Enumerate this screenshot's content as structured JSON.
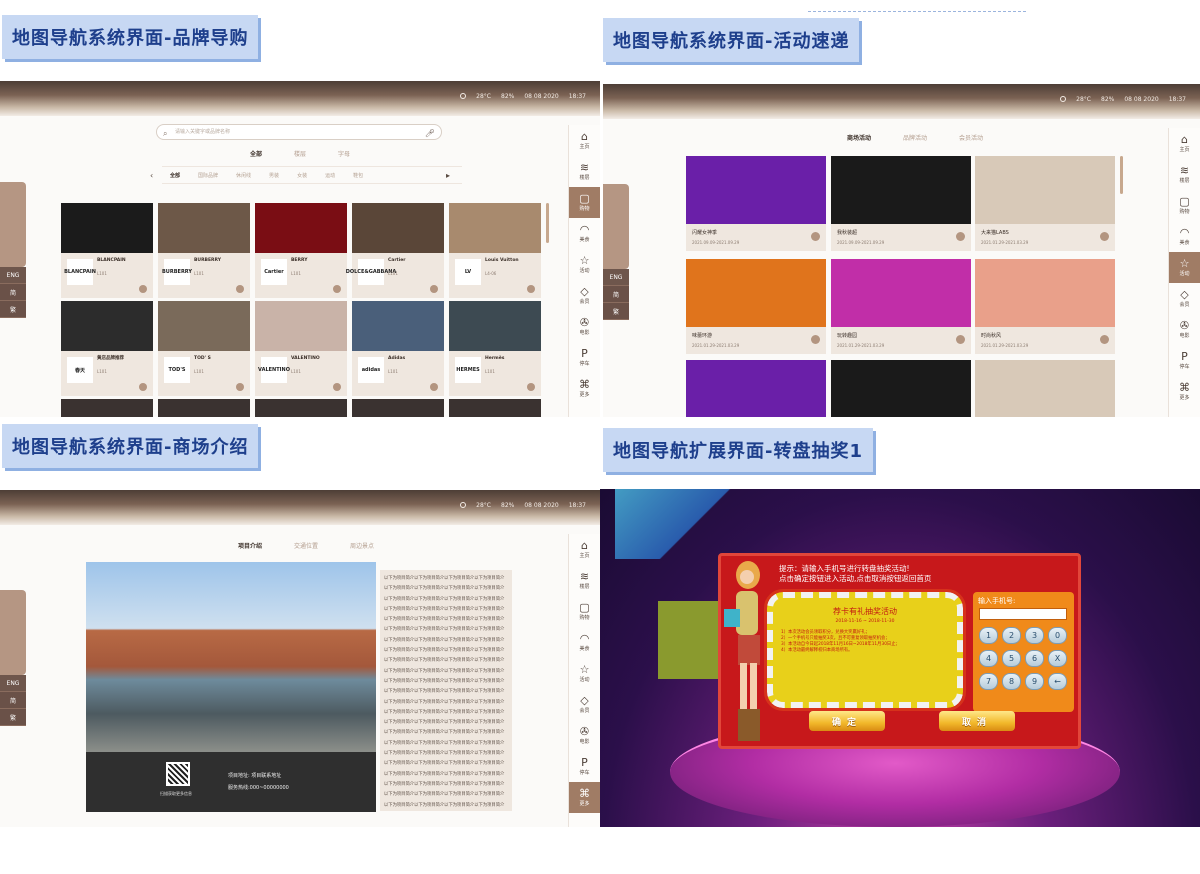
{
  "sections": [
    {
      "title": "地图导航系统界面-品牌导购"
    },
    {
      "title": "地图导航系统界面-活动速递"
    },
    {
      "title": "地图导航系统界面-商场介绍"
    },
    {
      "title": "地图导航扩展界面-转盘抽奖1"
    }
  ],
  "status": {
    "temp": "28°C",
    "humidity": "82%",
    "date": "08 08 2020",
    "time": "18:37"
  },
  "rail": [
    {
      "label": "主页",
      "icon": "home-icon",
      "glyph": "⌂"
    },
    {
      "label": "楼层",
      "icon": "layers-icon",
      "glyph": "≋"
    },
    {
      "label": "购物",
      "icon": "shopping-bag-icon",
      "glyph": "▢"
    },
    {
      "label": "美食",
      "icon": "dish-icon",
      "glyph": "◠"
    },
    {
      "label": "活动",
      "icon": "star-icon",
      "glyph": "☆"
    },
    {
      "label": "会员",
      "icon": "diamond-icon",
      "glyph": "◇"
    },
    {
      "label": "电影",
      "icon": "film-reel-icon",
      "glyph": "✇"
    },
    {
      "label": "停车",
      "icon": "parking-icon",
      "glyph": "P"
    },
    {
      "label": "更多",
      "icon": "gamepad-icon",
      "glyph": "⌘"
    }
  ],
  "lang": {
    "eng": "ENG",
    "simplified": "简",
    "traditional": "繁"
  },
  "brand": {
    "search_placeholder": "请输入关键字或品牌名称",
    "tabs": [
      "全部",
      "楼层",
      "字母"
    ],
    "categories": [
      "全部",
      "国际品牌",
      "休闲线",
      "男装",
      "女装",
      "运动",
      "鞋包"
    ],
    "cards": [
      {
        "name": "BLANCPAIN",
        "logo": "BLANCPAIN",
        "info": "L101",
        "color": "#1b1b1b"
      },
      {
        "name": "BURBERRY",
        "logo": "BURBERRY",
        "info": "L101",
        "color": "#6d5848"
      },
      {
        "name": "BERRY",
        "logo": "Cartier",
        "info": "L101",
        "color": "#7a0d14"
      },
      {
        "name": "Cartier",
        "logo": "DOLCE&GABBANA",
        "info": "L101",
        "color": "#5a4638"
      },
      {
        "name": "DOLCE &GABBANA",
        "logo": "LV",
        "info": "L101",
        "color": "#8a6a4c"
      },
      {
        "name": "Louis Vuitton",
        "logo": "LV",
        "info": "L4-06",
        "color": "#a88a6e"
      },
      {
        "name": "黄店品牌推荐",
        "logo": "春天",
        "info": "L101",
        "color": "#2c2c2c"
      },
      {
        "name": "TOD' S",
        "logo": "TOD'S",
        "info": "L101",
        "color": "#7a6a5a"
      },
      {
        "name": "VALENTINO",
        "logo": "VALENTINO",
        "info": "L101",
        "color": "#c9b3a8"
      },
      {
        "name": "Adidas",
        "logo": "adidas",
        "info": "L101",
        "color": "#4a5f7a"
      },
      {
        "name": "Hermès",
        "logo": "HERMES",
        "info": "L101",
        "color": "#3d4a52"
      }
    ]
  },
  "activity": {
    "tabs": [
      "商场活动",
      "品牌活动",
      "会员活动"
    ],
    "cards": [
      {
        "title": "闪耀女神季",
        "date": "2021.09.09-2021.09.29",
        "color": "#6a1fa8"
      },
      {
        "title": "我秋装超",
        "date": "2021.09.09-2021.09.29",
        "color": "#1a1a1a"
      },
      {
        "title": "大来猫LABS",
        "date": "2021.01.29-2021.03.29",
        "color": "#d8c9b8"
      },
      {
        "title": "味蕾环游",
        "date": "2021.01.29-2021.03.29",
        "color": "#e0741c"
      },
      {
        "title": "玩转趣园",
        "date": "2021.01.29-2021.03.29",
        "color": "#c12ea8"
      },
      {
        "title": "时尚秋风",
        "date": "2021.01.29-2021.03.29",
        "color": "#e9a08a"
      }
    ]
  },
  "mall": {
    "tabs": [
      "项目介绍",
      "交通位置",
      "周边景点"
    ],
    "qr_caption": "扫描获取更多信息",
    "address": "项目地址: 项目联系地址",
    "hotline": "服务热线:000~00000000",
    "intro_text": "以下为项目简介以下为项目简介以下为项目简介以下为项目简介以下为项目简介以下为项目简介以下为项目简介以下为项目简介以下为项目简介以下为项目简介以下为项目简介以下为项目简介以下为项目简介以下为项目简介以下为项目简介以下为项目简介以下为项目简介以下为项目简介以下为项目简介以下为项目简介以下为项目简介以下为项目简介以下为项目简介以下为项目简介以下为项目简介以下为项目简介以下为项目简介以下为项目简介以下为项目简介以下为项目简介以下为项目简介以下为项目简介以下为项目简介以下为项目简介以下为项目简介以下为项目简介以下为项目简介以下为项目简介以下为项目简介以下为项目简介以下为项目简介以下为项目简介以下为项目简介以下为项目简介以下为项目简介以下为项目简介以下为项目简介以下为项目简介以下为项目简介以下为项目简介以下为项目简介以下为项目简介以下为项目简介以下为项目简介以下为项目简介以下为项目简介以下为项目简介以下为项目简介以下为项目简介以下为项目简介以下为项目简介以下为项目简介以下为项目简介以下为项目简介以下为项目简介以下为项目简介以下为项目简介以下为项目简介以下为项目简介以下为项目简介以下为项目简介以下为项目简介以下为项目简介以下为项目简介以下为项目简介以下为项目简介以下为项目简介以下为项目简介以下为项目简介以下为项目简介以下为项目简介以下为项目简介以下为项目简介以下为项目简介以下为项目简介以下为项目简介以下为项目简介以下为项目简介以下为项目简介以下为项目简介以下为项目简介以下为项目简介以下为项目简介以下为项目简介以下为项目简介以下为项目简介以下为项目简介以下为项目简介以下为项目简介以下为项目简介以下为项目简介以下为项目简介以下为项目简介以下为项目简介以下为项目简介以下为项目简介以下为项目简介以下为项目简介以下为项目简介以下为项目简介"
  },
  "lottery": {
    "tip_line1": "提示：请输入手机号进行转盘抽奖活动!",
    "tip_line2": "点击确定按钮进入活动,点击取消按钮返回首页",
    "card_title": "荐卡有礼抽奖活动",
    "card_date": "2018-11-16 ~ 2018-11-30",
    "rules": "1）本次活动会员领取积分，兑换大奖赢好礼；\n2）一个手机号只能抽奖3次，且不可重复领取抽奖机会；\n3）本活动自今日起2018年11月16日~2018年11月30日止；\n4）本活动最终解释权归本商场所有。",
    "phone_label": "输入手机号:",
    "keys": [
      "1",
      "2",
      "3",
      "0",
      "4",
      "5",
      "6",
      "X",
      "7",
      "8",
      "9",
      "←"
    ],
    "confirm": "确定",
    "cancel": "取消"
  }
}
